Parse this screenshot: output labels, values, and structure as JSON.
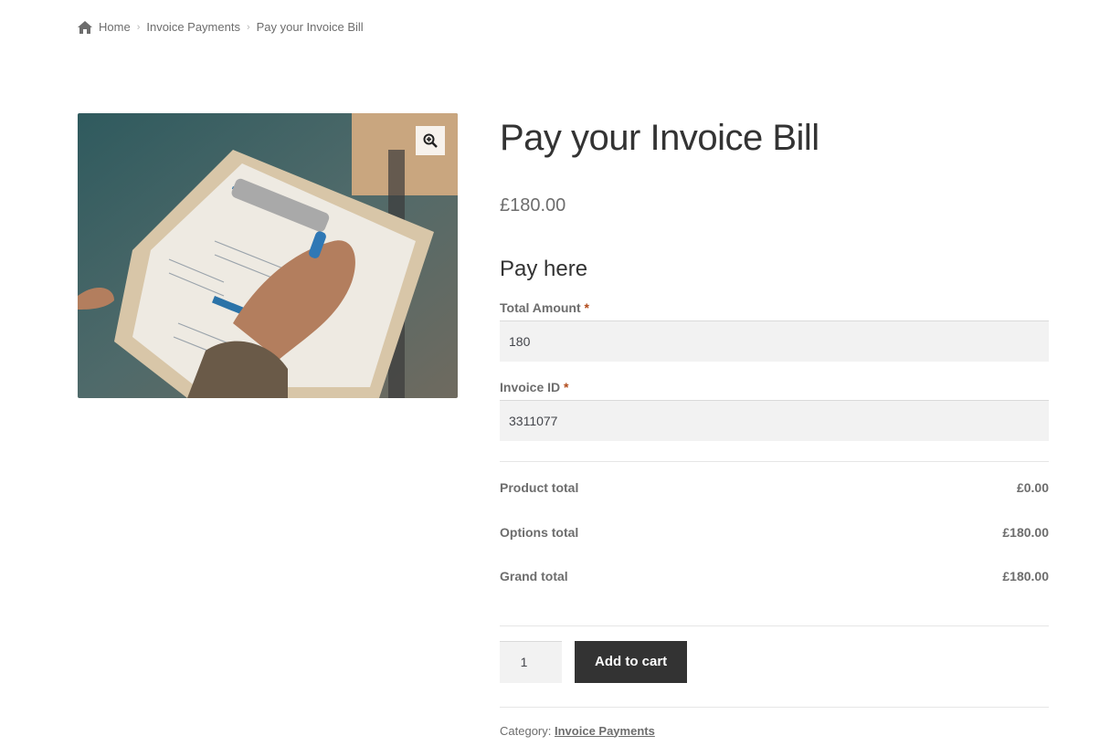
{
  "breadcrumb": {
    "items": [
      "Home",
      "Invoice Payments",
      "Pay your Invoice Bill"
    ],
    "separator": "›"
  },
  "product": {
    "title": "Pay your Invoice Bill",
    "price": "£180.00",
    "image_icon": "invoice-clipboard-photo",
    "zoom_icon": "zoom-in-icon"
  },
  "form": {
    "section_title": "Pay here",
    "total_amount": {
      "label": "Total Amount",
      "required": "*",
      "value": "180"
    },
    "invoice_id": {
      "label": "Invoice ID",
      "required": "*",
      "value": "3311077"
    }
  },
  "totals": {
    "product_total": {
      "label": "Product total",
      "value": "£0.00"
    },
    "options_total": {
      "label": "Options total",
      "value": "£180.00"
    },
    "grand_total": {
      "label": "Grand total",
      "value": "£180.00"
    }
  },
  "cart": {
    "quantity": "1",
    "add_label": "Add to cart"
  },
  "meta": {
    "category_label": "Category:",
    "category_value": "Invoice Payments"
  },
  "colors": {
    "button_bg": "#333333",
    "required": "#b14a1a",
    "input_bg": "#f2f2f2"
  }
}
